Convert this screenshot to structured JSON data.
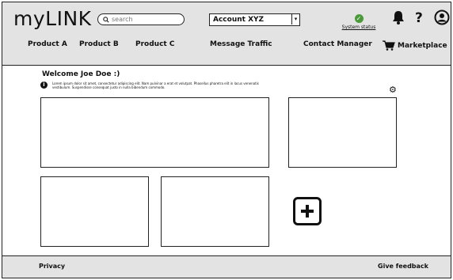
{
  "header": {
    "logo": "myLINK",
    "search": {
      "placeholder": "search",
      "value": ""
    },
    "account": {
      "selected": "Account XYZ"
    },
    "system_status": {
      "label": "System status",
      "color": "#4a9a3a"
    },
    "icons": [
      "bell-icon",
      "help-icon",
      "user-icon"
    ]
  },
  "nav": {
    "items": [
      {
        "label": "Product A"
      },
      {
        "label": "Product B"
      },
      {
        "label": "Product C"
      },
      {
        "label": "Message Traffic"
      },
      {
        "label": "Contact Manager"
      },
      {
        "label": "Marketplace"
      }
    ]
  },
  "main": {
    "welcome": "Welcome Joe Doe :)",
    "info_text": "Lorem ipsum dolor sit amet, consectetur adipiscing elit. Nam pulvinar a erat et volutpat. Phasellus pharetra elit in lacus venenatis vestibulum. Suspendisse consequat justo in nulla bibendum commodo."
  },
  "footer": {
    "privacy": "Privacy",
    "feedback": "Give feedback"
  }
}
